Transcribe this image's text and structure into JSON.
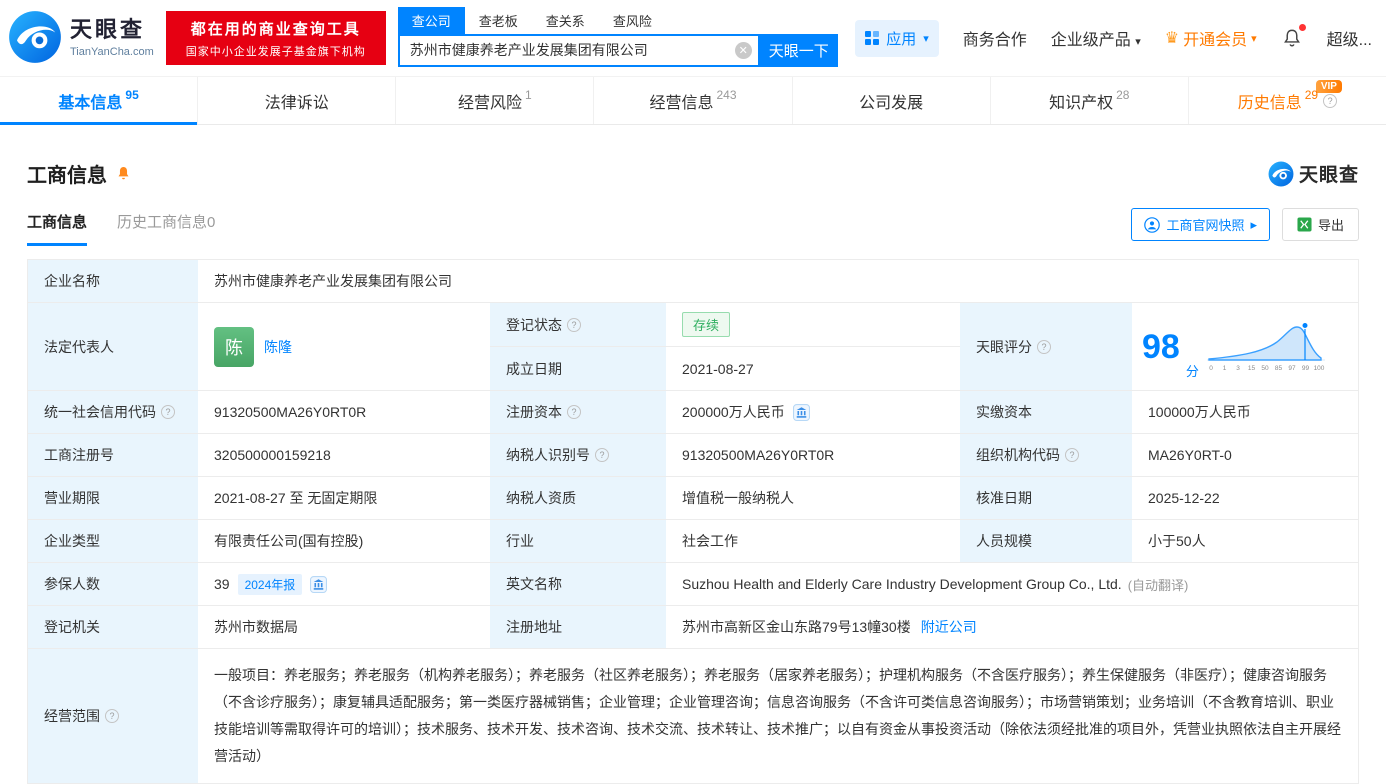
{
  "header": {
    "logo": {
      "title": "天眼查",
      "subtitle": "TianYanCha.com"
    },
    "promo": {
      "line1": "都在用的商业查询工具",
      "line2": "国家中小企业发展子基金旗下机构"
    },
    "search": {
      "tabs": [
        {
          "label": "查公司"
        },
        {
          "label": "查老板"
        },
        {
          "label": "查关系"
        },
        {
          "label": "查风险"
        }
      ],
      "value": "苏州市健康养老产业发展集团有限公司",
      "button": "天眼一下"
    },
    "nav": {
      "apps": "应用",
      "cooperation": "商务合作",
      "enterprise": "企业级产品",
      "vip": "开通会员",
      "super": "超级..."
    }
  },
  "tabbar": {
    "vip_badge": "VIP",
    "tabs": [
      {
        "label": "基本信息",
        "count": "95"
      },
      {
        "label": "法律诉讼",
        "count": ""
      },
      {
        "label": "经营风险",
        "count": "1"
      },
      {
        "label": "经营信息",
        "count": "243"
      },
      {
        "label": "公司发展",
        "count": ""
      },
      {
        "label": "知识产权",
        "count": "28"
      },
      {
        "label": "历史信息",
        "count": "29"
      }
    ]
  },
  "section": {
    "title": "工商信息",
    "brand": "天眼查",
    "subtabs": [
      {
        "label": "工商信息"
      },
      {
        "label": "历史工商信息0"
      }
    ],
    "snapshot_button": "工商官网快照",
    "export_button": "导出"
  },
  "info": {
    "company_name": {
      "label": "企业名称",
      "value": "苏州市健康养老产业发展集团有限公司"
    },
    "legal_rep": {
      "label": "法定代表人",
      "avatar": "陈",
      "name": "陈隆"
    },
    "reg_status": {
      "label": "登记状态",
      "value": "存续"
    },
    "establish_date": {
      "label": "成立日期",
      "value": "2021-08-27"
    },
    "score": {
      "label": "天眼评分",
      "value": "98",
      "unit": "分",
      "ticks": [
        "0",
        "1",
        "3",
        "15",
        "50",
        "85",
        "97",
        "99",
        "100"
      ]
    },
    "credit_code": {
      "label": "统一社会信用代码",
      "value": "91320500MA26Y0RT0R"
    },
    "reg_capital": {
      "label": "注册资本",
      "value": "200000万人民币"
    },
    "paid_capital": {
      "label": "实缴资本",
      "value": "100000万人民币"
    },
    "reg_number": {
      "label": "工商注册号",
      "value": "320500000159218"
    },
    "taxpayer_id": {
      "label": "纳税人识别号",
      "value": "91320500MA26Y0RT0R"
    },
    "org_code": {
      "label": "组织机构代码",
      "value": "MA26Y0RT-0"
    },
    "business_term": {
      "label": "营业期限",
      "value": "2021-08-27 至 无固定期限"
    },
    "taxpayer_quality": {
      "label": "纳税人资质",
      "value": "增值税一般纳税人"
    },
    "approval_date": {
      "label": "核准日期",
      "value": "2025-12-22"
    },
    "company_type": {
      "label": "企业类型",
      "value": "有限责任公司(国有控股)"
    },
    "industry": {
      "label": "行业",
      "value": "社会工作"
    },
    "staff_size": {
      "label": "人员规模",
      "value": "小于50人"
    },
    "insured": {
      "label": "参保人数",
      "value": "39",
      "badge": "2024年报"
    },
    "english_name": {
      "label": "英文名称",
      "value": "Suzhou Health and Elderly Care Industry Development Group Co., Ltd.",
      "note": "(自动翻译)"
    },
    "reg_authority": {
      "label": "登记机关",
      "value": "苏州市数据局"
    },
    "reg_address": {
      "label": "注册地址",
      "value": "苏州市高新区金山东路79号13幢30楼",
      "link": "附近公司"
    },
    "business_scope": {
      "label": "经营范围",
      "value": "一般项目：养老服务；养老服务（机构养老服务）；养老服务（社区养老服务）；养老服务（居家养老服务）；护理机构服务（不含医疗服务）；养生保健服务（非医疗）；健康咨询服务（不含诊疗服务）；康复辅具适配服务；第一类医疗器械销售；企业管理；企业管理咨询；信息咨询服务（不含许可类信息咨询服务）；市场营销策划；业务培训（不含教育培训、职业技能培训等需取得许可的培训）；技术服务、技术开发、技术咨询、技术交流、技术转让、技术推广；以自有资金从事投资活动（除依法须经批准的项目外，凭营业执照依法自主开展经营活动）"
    }
  }
}
